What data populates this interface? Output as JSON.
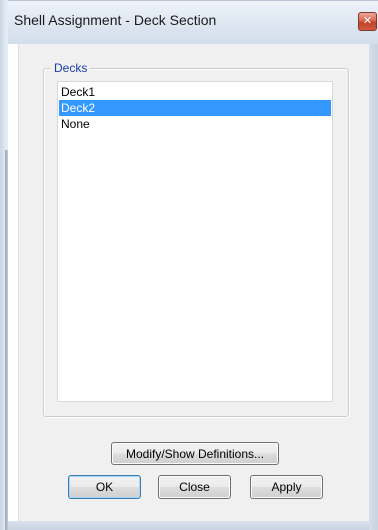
{
  "window": {
    "title": "Shell Assignment - Deck Section",
    "close_glyph": "✕"
  },
  "decks_group": {
    "label": "Decks",
    "items": [
      {
        "label": "Deck1",
        "selected": false
      },
      {
        "label": "Deck2",
        "selected": true
      },
      {
        "label": "None",
        "selected": false
      }
    ]
  },
  "buttons": {
    "modify_show": "Modify/Show Definitions...",
    "ok": "OK",
    "close": "Close",
    "apply": "Apply"
  },
  "colors": {
    "selection": "#3399ff",
    "group_label": "#1a3da8",
    "close_button": "#c2412a"
  }
}
